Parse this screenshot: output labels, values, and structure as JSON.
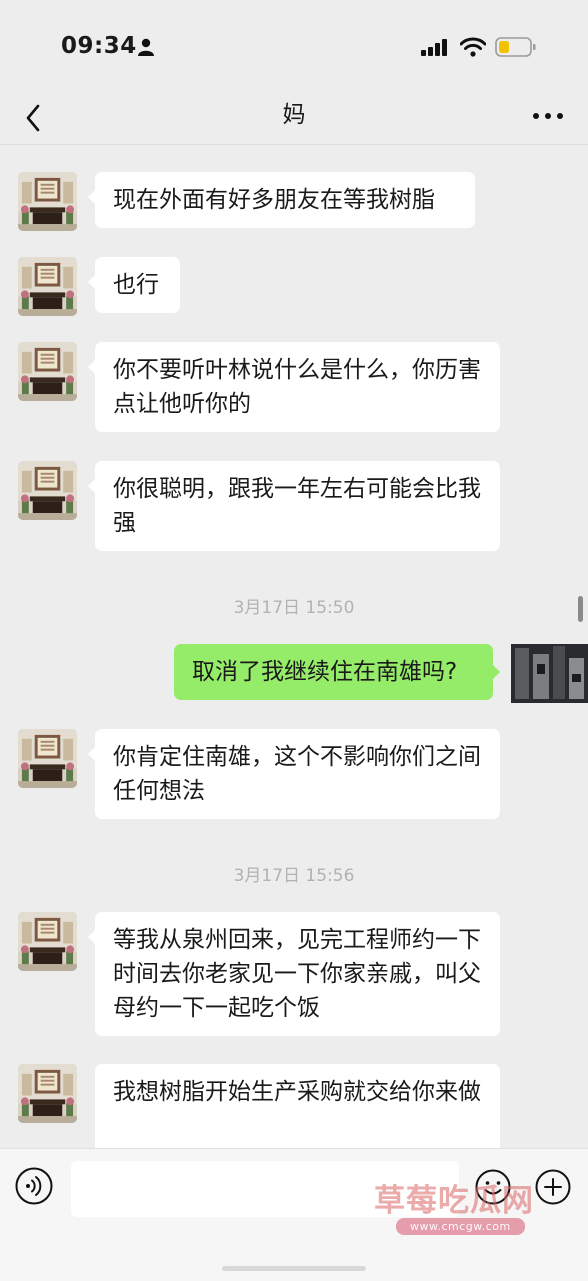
{
  "status_bar": {
    "time": "09:34"
  },
  "header": {
    "title": "妈"
  },
  "messages": [
    {
      "text": "现在外面有好多朋友在等我树脂"
    },
    {
      "text": "也行"
    },
    {
      "text": "你不要听叶林说什么是什么，你历害点让他听你的"
    },
    {
      "text": "你很聪明，跟我一年左右可能会比我强"
    },
    {
      "time": "3月17日 15:50"
    },
    {
      "text": "取消了我继续住在南雄吗?"
    },
    {
      "text": "你肯定住南雄，这个不影响你们之间任何想法"
    },
    {
      "time": "3月17日 15:56"
    },
    {
      "text": "等我从泉州回来，见完工程师约一下时间去你老家见一下你家亲戚，叫父母约一下一起吃个饭"
    },
    {
      "text": "我想树脂开始生产采购就交给你来做"
    }
  ],
  "watermark": {
    "title": "草莓吃瓜网",
    "url": "www.cmcgw.com"
  },
  "colors": {
    "self_bubble": "#95ec69",
    "other_bubble": "#ffffff",
    "background": "#ededed"
  },
  "icons": [
    "person-icon",
    "signal-icon",
    "wifi-icon",
    "battery-icon",
    "back-icon",
    "more-icon",
    "voice-icon",
    "emoji-icon",
    "plus-icon"
  ]
}
